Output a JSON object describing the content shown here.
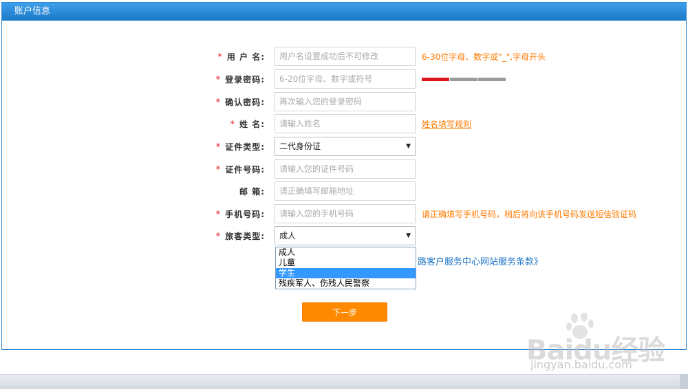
{
  "panel": {
    "title": "账户信息"
  },
  "form": {
    "username": {
      "label": "用 户 名:",
      "placeholder": "用户名设置成功后不可修改",
      "hint": "6-30位字母、数字或\"_\",字母开头"
    },
    "password": {
      "label": "登录密码:",
      "placeholder": "6-20位字母、数字或符号"
    },
    "confirm_password": {
      "label": "确认密码:",
      "placeholder": "再次输入您的登录密码"
    },
    "name": {
      "label": "姓 名:",
      "placeholder": "请输入姓名",
      "hint": "姓名填写规则"
    },
    "id_type": {
      "label": "证件类型:",
      "value": "二代身份证"
    },
    "id_number": {
      "label": "证件号码:",
      "placeholder": "请输入您的证件号码"
    },
    "email": {
      "label": "邮 箱:",
      "placeholder": "请正确填写邮箱地址"
    },
    "phone": {
      "label": "手机号码:",
      "placeholder": "请输入您的手机号码",
      "hint": "请正确填写手机号码，稍后将向该手机号码发送短信验证码"
    },
    "passenger_type": {
      "label": "旅客类型:",
      "value": "成人",
      "options": [
        "成人",
        "儿童",
        "学生",
        "残疾军人、伤残人民警察"
      ],
      "highlighted": "学生"
    },
    "required_mark": "*",
    "terms_text": "路客户服务中心网站服务条款》",
    "next_label": "下一步"
  },
  "password_strength": {
    "level": 1,
    "segments": 3
  },
  "icons": {
    "dropdown_arrow": "▼"
  },
  "watermark": {
    "brand": "Bai",
    "brand2": "du",
    "cn": "经验",
    "url": "jingyan.baidu.com"
  }
}
